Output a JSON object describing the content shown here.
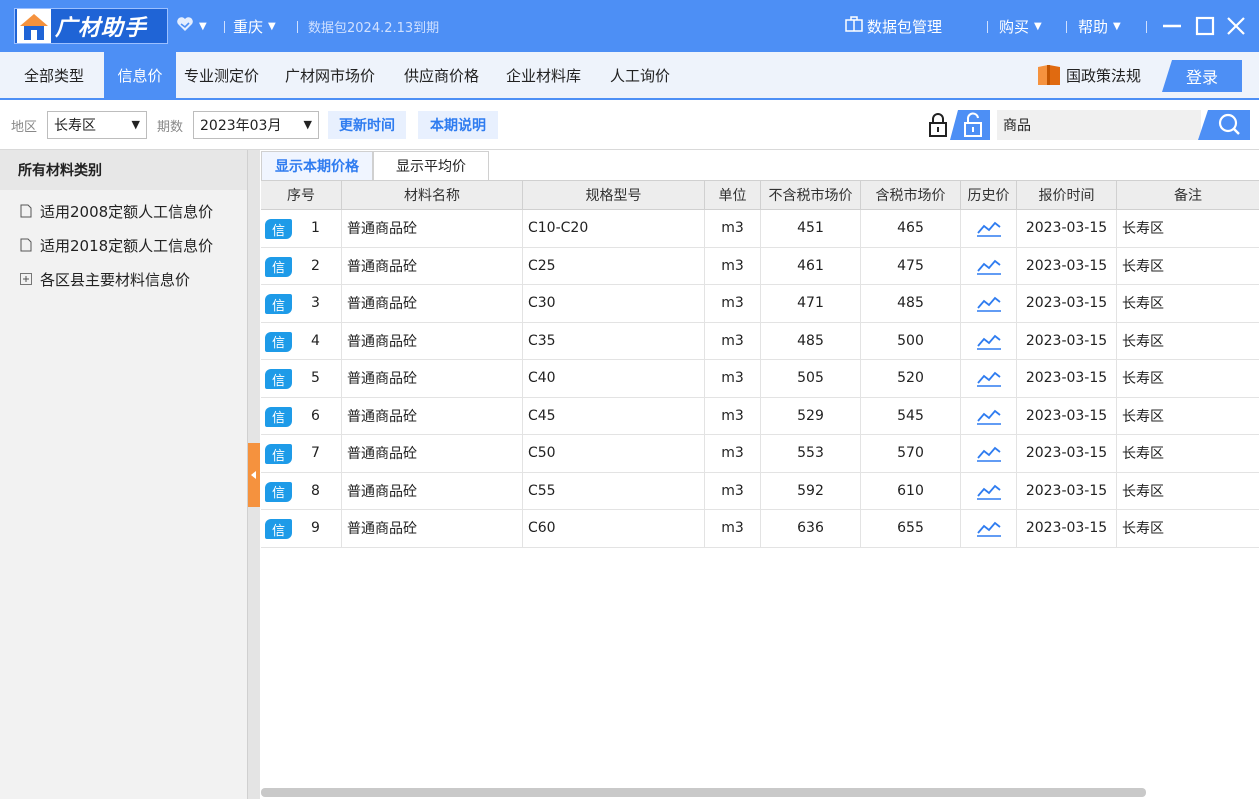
{
  "titlebar": {
    "app_name": "广材助手",
    "city": "重庆",
    "package_expiry": "数据包2024.2.13到期",
    "package_mgmt": "数据包管理",
    "buy": "购买",
    "help": "帮助"
  },
  "nav": {
    "tabs": [
      "全部类型",
      "信息价",
      "专业测定价",
      "广材网市场价",
      "供应商价格",
      "企业材料库",
      "人工询价"
    ],
    "active": "信息价",
    "policy": "国政策法规",
    "login": "登录"
  },
  "filters": {
    "region_label": "地区",
    "region_value": "长寿区",
    "period_label": "期数",
    "period_value": "2023年03月",
    "update_time": "更新时间",
    "period_note": "本期说明",
    "search_value": "商品"
  },
  "sidebar": {
    "header": "所有材料类别",
    "items": [
      {
        "label": "适用2008定额人工信息价",
        "icon": "document-icon"
      },
      {
        "label": "适用2018定额人工信息价",
        "icon": "document-icon"
      },
      {
        "label": "各区县主要材料信息价",
        "icon": "expand-plus-icon"
      }
    ]
  },
  "subtabs": {
    "current": "显示本期价格",
    "average": "显示平均价"
  },
  "table": {
    "columns": [
      "序号",
      "材料名称",
      "规格型号",
      "单位",
      "不含税市场价",
      "含税市场价",
      "历史价",
      "报价时间",
      "备注"
    ],
    "badge": "信",
    "rows": [
      {
        "seq": "1",
        "name": "普通商品砼",
        "spec": "C10-C20",
        "unit": "m3",
        "ex_tax": "451",
        "inc_tax": "465",
        "date": "2023-03-15",
        "note": "长寿区"
      },
      {
        "seq": "2",
        "name": "普通商品砼",
        "spec": "C25",
        "unit": "m3",
        "ex_tax": "461",
        "inc_tax": "475",
        "date": "2023-03-15",
        "note": "长寿区"
      },
      {
        "seq": "3",
        "name": "普通商品砼",
        "spec": "C30",
        "unit": "m3",
        "ex_tax": "471",
        "inc_tax": "485",
        "date": "2023-03-15",
        "note": "长寿区"
      },
      {
        "seq": "4",
        "name": "普通商品砼",
        "spec": "C35",
        "unit": "m3",
        "ex_tax": "485",
        "inc_tax": "500",
        "date": "2023-03-15",
        "note": "长寿区"
      },
      {
        "seq": "5",
        "name": "普通商品砼",
        "spec": "C40",
        "unit": "m3",
        "ex_tax": "505",
        "inc_tax": "520",
        "date": "2023-03-15",
        "note": "长寿区"
      },
      {
        "seq": "6",
        "name": "普通商品砼",
        "spec": "C45",
        "unit": "m3",
        "ex_tax": "529",
        "inc_tax": "545",
        "date": "2023-03-15",
        "note": "长寿区"
      },
      {
        "seq": "7",
        "name": "普通商品砼",
        "spec": "C50",
        "unit": "m3",
        "ex_tax": "553",
        "inc_tax": "570",
        "date": "2023-03-15",
        "note": "长寿区"
      },
      {
        "seq": "8",
        "name": "普通商品砼",
        "spec": "C55",
        "unit": "m3",
        "ex_tax": "592",
        "inc_tax": "610",
        "date": "2023-03-15",
        "note": "长寿区"
      },
      {
        "seq": "9",
        "name": "普通商品砼",
        "spec": "C60",
        "unit": "m3",
        "ex_tax": "636",
        "inc_tax": "655",
        "date": "2023-03-15",
        "note": "长寿区"
      }
    ]
  },
  "colors": {
    "brand_blue": "#4d8ff5",
    "badge_blue": "#1e9be8",
    "accent_orange": "#f5923e"
  }
}
